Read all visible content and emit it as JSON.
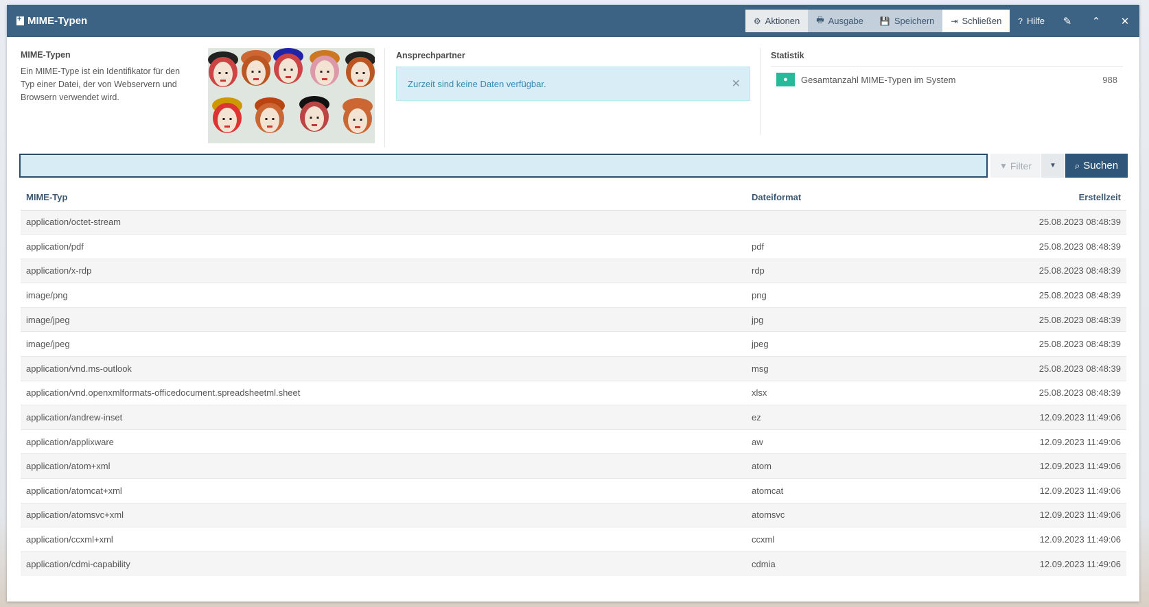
{
  "window": {
    "title": "MIME-Typen",
    "actions": [
      {
        "label": "Aktionen",
        "icon": "cogs-icon"
      },
      {
        "label": "Ausgabe",
        "icon": "print-icon"
      },
      {
        "label": "Speichern",
        "icon": "save-icon"
      },
      {
        "label": "Schließen",
        "icon": "sign-out-icon"
      },
      {
        "label": "Hilfe",
        "icon": "question-circle-icon"
      }
    ],
    "icon_buttons": [
      "edit-icon",
      "chevron-up-icon",
      "close-icon"
    ]
  },
  "info": {
    "title": "MIME-Typen",
    "description": "Ein MIME-Type ist ein Identifikator für den Typ einer Datei, der von Webservern und Browsern verwendet wird."
  },
  "contacts": {
    "title": "Ansprechpartner",
    "alert": "Zurzeit sind keine Daten verfügbar."
  },
  "statistics": {
    "title": "Statistik",
    "label": "Gesamtanzahl MIME-Typen im System",
    "value": "988"
  },
  "search": {
    "value": "",
    "filter_label": "Filter",
    "search_label": "Suchen"
  },
  "table": {
    "headers": [
      "MIME-Typ",
      "Dateiformat",
      "Erstellzeit"
    ],
    "rows": [
      [
        "application/octet-stream",
        "",
        "25.08.2023 08:48:39"
      ],
      [
        "application/pdf",
        "pdf",
        "25.08.2023 08:48:39"
      ],
      [
        "application/x-rdp",
        "rdp",
        "25.08.2023 08:48:39"
      ],
      [
        "image/png",
        "png",
        "25.08.2023 08:48:39"
      ],
      [
        "image/jpeg",
        "jpg",
        "25.08.2023 08:48:39"
      ],
      [
        "image/jpeg",
        "jpeg",
        "25.08.2023 08:48:39"
      ],
      [
        "application/vnd.ms-outlook",
        "msg",
        "25.08.2023 08:48:39"
      ],
      [
        "application/vnd.openxmlformats-officedocument.spreadsheetml.sheet",
        "xlsx",
        "25.08.2023 08:48:39"
      ],
      [
        "application/andrew-inset",
        "ez",
        "12.09.2023 11:49:06"
      ],
      [
        "application/applixware",
        "aw",
        "12.09.2023 11:49:06"
      ],
      [
        "application/atom+xml",
        "atom",
        "12.09.2023 11:49:06"
      ],
      [
        "application/atomcat+xml",
        "atomcat",
        "12.09.2023 11:49:06"
      ],
      [
        "application/atomsvc+xml",
        "atomsvc",
        "12.09.2023 11:49:06"
      ],
      [
        "application/ccxml+xml",
        "ccxml",
        "12.09.2023 11:49:06"
      ],
      [
        "application/cdmi-capability",
        "cdmia",
        "12.09.2023 11:49:06"
      ]
    ]
  },
  "colors": {
    "titlebar": "#3d6384",
    "accent": "#2f5679",
    "stat_icon": "#26b99a",
    "alert_bg": "#d9edf7"
  }
}
